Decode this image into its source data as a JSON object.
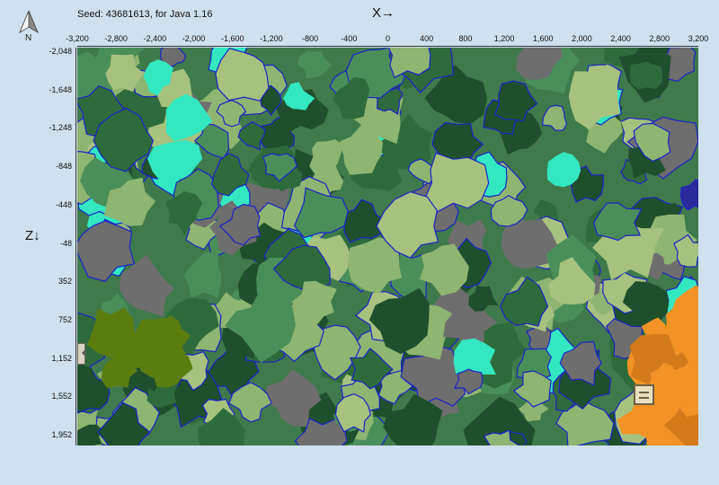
{
  "seed_text": "Seed: 43681613, for Java 1.16",
  "compass_label": "N",
  "x_axis_label": "X→",
  "z_axis_label": "Z↓",
  "x_ticks": [
    "-3,200",
    "-2,800",
    "-2,400",
    "-2,000",
    "-1,600",
    "-1,200",
    "-800",
    "-400",
    "0",
    "400",
    "800",
    "1,200",
    "1,600",
    "2,000",
    "2,400",
    "2,800",
    "3,200"
  ],
  "z_ticks": [
    "-2,048",
    "-1,648",
    "-1,248",
    "-848",
    "-448",
    "-48",
    "352",
    "752",
    "1,152",
    "1,552",
    "1,952"
  ],
  "x_range": [
    -3200,
    3200
  ],
  "z_range": [
    -2048,
    2000
  ],
  "colors": {
    "background": "#cfe0ee",
    "forest": "#2e6b3c",
    "dark_forest": "#1f4f2c",
    "plains": "#8fb572",
    "mountains": "#6e6e6e",
    "warm_ocean": "#33e8c0",
    "river": "#1b23c8",
    "savanna": "#f39325",
    "jungle": "#5b7d10"
  },
  "icons": {
    "compass": "north-arrow-icon",
    "left_nav": "chevron-left-icon",
    "marker": "village-marker-icon"
  }
}
